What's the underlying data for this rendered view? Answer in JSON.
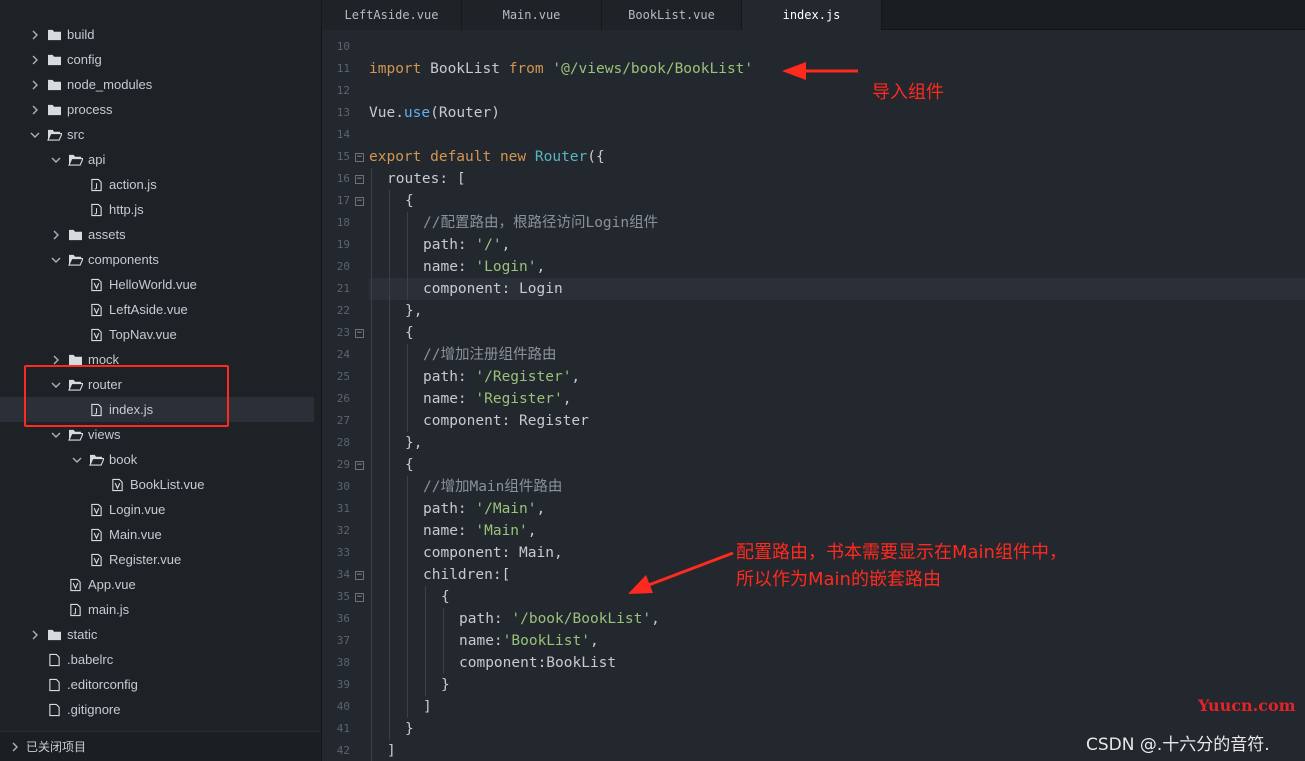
{
  "sidebar": {
    "tree": [
      {
        "label": "build",
        "type": "folder",
        "state": "collapsed",
        "depth": 0
      },
      {
        "label": "config",
        "type": "folder",
        "state": "collapsed",
        "depth": 0
      },
      {
        "label": "node_modules",
        "type": "folder",
        "state": "collapsed",
        "depth": 0
      },
      {
        "label": "process",
        "type": "folder",
        "state": "collapsed",
        "depth": 0
      },
      {
        "label": "src",
        "type": "folder",
        "state": "expanded",
        "depth": 0
      },
      {
        "label": "api",
        "type": "folder",
        "state": "expanded",
        "depth": 1
      },
      {
        "label": "action.js",
        "type": "file",
        "depth": 2
      },
      {
        "label": "http.js",
        "type": "file",
        "depth": 2
      },
      {
        "label": "assets",
        "type": "folder",
        "state": "collapsed",
        "depth": 1
      },
      {
        "label": "components",
        "type": "folder",
        "state": "expanded",
        "depth": 1
      },
      {
        "label": "HelloWorld.vue",
        "type": "vue",
        "depth": 2
      },
      {
        "label": "LeftAside.vue",
        "type": "vue",
        "depth": 2
      },
      {
        "label": "TopNav.vue",
        "type": "vue",
        "depth": 2
      },
      {
        "label": "mock",
        "type": "folder",
        "state": "collapsed",
        "depth": 1
      },
      {
        "label": "router",
        "type": "folder",
        "state": "expanded",
        "depth": 1
      },
      {
        "label": "index.js",
        "type": "file",
        "depth": 2,
        "selected": true
      },
      {
        "label": "views",
        "type": "folder",
        "state": "expanded",
        "depth": 1
      },
      {
        "label": "book",
        "type": "folder",
        "state": "expanded",
        "depth": 2
      },
      {
        "label": "BookList.vue",
        "type": "vue",
        "depth": 3
      },
      {
        "label": "Login.vue",
        "type": "vue",
        "depth": 2
      },
      {
        "label": "Main.vue",
        "type": "vue",
        "depth": 2
      },
      {
        "label": "Register.vue",
        "type": "vue",
        "depth": 2
      },
      {
        "label": "App.vue",
        "type": "vue",
        "depth": 1
      },
      {
        "label": "main.js",
        "type": "file",
        "depth": 1
      },
      {
        "label": "static",
        "type": "folder",
        "state": "collapsed",
        "depth": 0
      },
      {
        "label": ".babelrc",
        "type": "plain",
        "depth": 0
      },
      {
        "label": ".editorconfig",
        "type": "plain",
        "depth": 0
      },
      {
        "label": ".gitignore",
        "type": "plain",
        "depth": 0
      }
    ],
    "closed_projects_label": "已关闭项目"
  },
  "tabs": [
    {
      "label": "LeftAside.vue",
      "active": false
    },
    {
      "label": "Main.vue",
      "active": false
    },
    {
      "label": "BookList.vue",
      "active": false
    },
    {
      "label": "index.js",
      "active": true
    }
  ],
  "editor": {
    "lines": [
      {
        "n": "10",
        "indent": 0,
        "tokens": []
      },
      {
        "n": "11",
        "indent": 0,
        "tokens": [
          [
            "kw",
            "import"
          ],
          [
            "t",
            " BookList "
          ],
          [
            "kw",
            "from"
          ],
          [
            "t",
            " "
          ],
          [
            "str",
            "'@/views/book/BookList'"
          ]
        ]
      },
      {
        "n": "12",
        "indent": 0,
        "tokens": []
      },
      {
        "n": "13",
        "indent": 0,
        "tokens": [
          [
            "t",
            "Vue."
          ],
          [
            "fn",
            "use"
          ],
          [
            "t",
            "(Router)"
          ]
        ]
      },
      {
        "n": "14",
        "indent": 0,
        "tokens": []
      },
      {
        "n": "15",
        "indent": 0,
        "fold": true,
        "tokens": [
          [
            "kw",
            "export default new"
          ],
          [
            "t",
            " "
          ],
          [
            "cls",
            "Router"
          ],
          [
            "t",
            "({"
          ]
        ]
      },
      {
        "n": "16",
        "indent": 1,
        "fold": true,
        "tokens": [
          [
            "t",
            "routes: ["
          ]
        ]
      },
      {
        "n": "17",
        "indent": 2,
        "fold": true,
        "tokens": [
          [
            "t",
            "{"
          ]
        ]
      },
      {
        "n": "18",
        "indent": 3,
        "tokens": [
          [
            "cm",
            "//配置路由，根路径访问Login组件"
          ]
        ]
      },
      {
        "n": "19",
        "indent": 3,
        "tokens": [
          [
            "t",
            "path: "
          ],
          [
            "str",
            "'/'"
          ],
          [
            "t",
            ","
          ]
        ]
      },
      {
        "n": "20",
        "indent": 3,
        "tokens": [
          [
            "t",
            "name: "
          ],
          [
            "str",
            "'Login'"
          ],
          [
            "t",
            ","
          ]
        ]
      },
      {
        "n": "21",
        "indent": 3,
        "current": true,
        "tokens": [
          [
            "t",
            "component: Login"
          ]
        ]
      },
      {
        "n": "22",
        "indent": 2,
        "tokens": [
          [
            "t",
            "},"
          ]
        ]
      },
      {
        "n": "23",
        "indent": 2,
        "fold": true,
        "tokens": [
          [
            "t",
            "{"
          ]
        ]
      },
      {
        "n": "24",
        "indent": 3,
        "tokens": [
          [
            "cm",
            "//增加注册组件路由"
          ]
        ]
      },
      {
        "n": "25",
        "indent": 3,
        "tokens": [
          [
            "t",
            "path: "
          ],
          [
            "str",
            "'/Register'"
          ],
          [
            "t",
            ","
          ]
        ]
      },
      {
        "n": "26",
        "indent": 3,
        "tokens": [
          [
            "t",
            "name: "
          ],
          [
            "str",
            "'Register'"
          ],
          [
            "t",
            ","
          ]
        ]
      },
      {
        "n": "27",
        "indent": 3,
        "tokens": [
          [
            "t",
            "component: Register"
          ]
        ]
      },
      {
        "n": "28",
        "indent": 2,
        "tokens": [
          [
            "t",
            "},"
          ]
        ]
      },
      {
        "n": "29",
        "indent": 2,
        "fold": true,
        "tokens": [
          [
            "t",
            "{"
          ]
        ]
      },
      {
        "n": "30",
        "indent": 3,
        "tokens": [
          [
            "cm",
            "//增加Main组件路由"
          ]
        ]
      },
      {
        "n": "31",
        "indent": 3,
        "tokens": [
          [
            "t",
            "path: "
          ],
          [
            "str",
            "'/Main'"
          ],
          [
            "t",
            ","
          ]
        ]
      },
      {
        "n": "32",
        "indent": 3,
        "tokens": [
          [
            "t",
            "name: "
          ],
          [
            "str",
            "'Main'"
          ],
          [
            "t",
            ","
          ]
        ]
      },
      {
        "n": "33",
        "indent": 3,
        "tokens": [
          [
            "t",
            "component: Main,"
          ]
        ]
      },
      {
        "n": "34",
        "indent": 3,
        "fold": true,
        "tokens": [
          [
            "t",
            "children:["
          ]
        ]
      },
      {
        "n": "35",
        "indent": 4,
        "fold": true,
        "tokens": [
          [
            "t",
            "{"
          ]
        ]
      },
      {
        "n": "36",
        "indent": 5,
        "tokens": [
          [
            "t",
            "path: "
          ],
          [
            "str",
            "'/book/BookList'"
          ],
          [
            "t",
            ","
          ]
        ]
      },
      {
        "n": "37",
        "indent": 5,
        "tokens": [
          [
            "t",
            "name:"
          ],
          [
            "str",
            "'BookList'"
          ],
          [
            "t",
            ","
          ]
        ]
      },
      {
        "n": "38",
        "indent": 5,
        "tokens": [
          [
            "t",
            "component:BookList"
          ]
        ]
      },
      {
        "n": "39",
        "indent": 4,
        "tokens": [
          [
            "t",
            "}"
          ]
        ]
      },
      {
        "n": "40",
        "indent": 3,
        "tokens": [
          [
            "t",
            "]"
          ]
        ]
      },
      {
        "n": "41",
        "indent": 2,
        "tokens": [
          [
            "t",
            "}"
          ]
        ]
      },
      {
        "n": "42",
        "indent": 1,
        "tokens": [
          [
            "t",
            "]"
          ]
        ]
      }
    ]
  },
  "annotations": {
    "import_note": "导入组件",
    "route_note_line1": "配置路由，书本需要显示在Main组件中，",
    "route_note_line2": "所以作为Main的嵌套路由",
    "accent_color": "#ff2a1f"
  },
  "watermarks": {
    "site": "Yuucn.com",
    "author": "CSDN @.十六分的音符."
  }
}
